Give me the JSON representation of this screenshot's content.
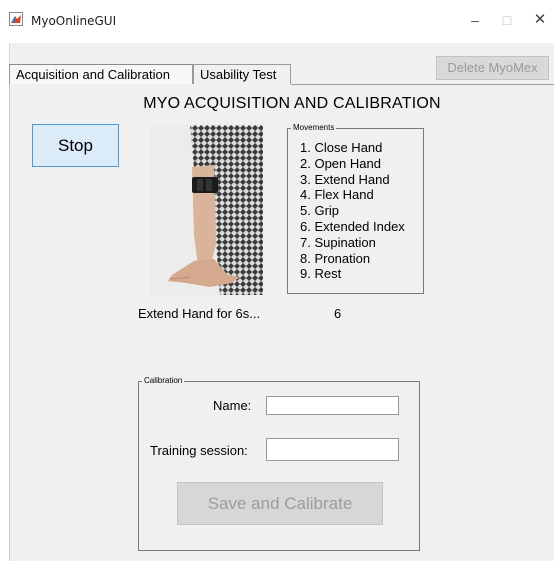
{
  "window": {
    "title": "MyoOnlineGUI",
    "minimize_icon": "minimize-icon",
    "maximize_icon": "maximize-icon",
    "close_icon": "close-icon",
    "minimize_glyph": "–",
    "maximize_glyph": "□",
    "close_glyph": "✕"
  },
  "tabs": [
    {
      "label": "Acquisition and Calibration",
      "selected": true
    },
    {
      "label": "Usability Test",
      "selected": false
    }
  ],
  "toolbar": {
    "delete_label": "Delete MyoMex"
  },
  "main": {
    "heading": "MYO ACQUISITION AND CALIBRATION",
    "stop_label": "Stop",
    "photo_icon": "forearm-photo",
    "status_text": "Extend Hand for 6s...",
    "countdown": "6"
  },
  "movements": {
    "group_label": "Movements",
    "items": [
      "1. Close Hand",
      "2. Open Hand",
      "3. Extend Hand",
      "4. Flex Hand",
      "5. Grip",
      "6. Extended Index",
      "7. Supination",
      "8. Pronation",
      "9. Rest"
    ]
  },
  "calibration": {
    "group_label": "Calibration",
    "name_label": "Name:",
    "name_value": "",
    "session_label": "Training session:",
    "session_value": "",
    "save_label": "Save and Calibrate"
  },
  "colors": {
    "background": "#f0f0f0",
    "stop_button": "#dcebf8",
    "stop_border": "#4d9ad6",
    "disabled_button": "#d7d7d7",
    "disabled_text": "#9c9c9c"
  }
}
